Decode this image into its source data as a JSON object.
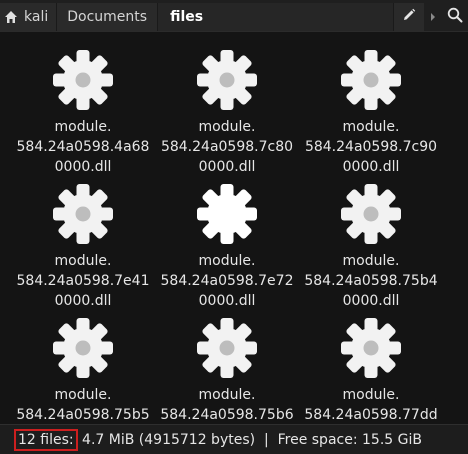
{
  "pathbar": {
    "crumbs": [
      "kali",
      "Documents",
      "files"
    ],
    "home_icon": "home-icon",
    "edit_icon": "pencil-icon",
    "next_icon": "chevron-right-icon",
    "search_icon": "search-icon"
  },
  "files": [
    {
      "line1": "module.",
      "line2": "584.24a0598.4a68",
      "line3": "0000.dll"
    },
    {
      "line1": "module.",
      "line2": "584.24a0598.7c80",
      "line3": "0000.dll"
    },
    {
      "line1": "module.",
      "line2": "584.24a0598.7c90",
      "line3": "0000.dll"
    },
    {
      "line1": "module.",
      "line2": "584.24a0598.7e41",
      "line3": "0000.dll"
    },
    {
      "line1": "module.",
      "line2": "584.24a0598.7e72",
      "line3": "0000.dll"
    },
    {
      "line1": "module.",
      "line2": "584.24a0598.75b4",
      "line3": "0000.dll"
    },
    {
      "line1": "module.",
      "line2": "584.24a0598.75b5",
      "line3": ""
    },
    {
      "line1": "module.",
      "line2": "584.24a0598.75b6",
      "line3": ""
    },
    {
      "line1": "module.",
      "line2": "584.24a0598.77dd",
      "line3": ""
    }
  ],
  "file_icon": "gear-icon",
  "status": {
    "count": "12 files:",
    "details": " 4.7 MiB (4915712 bytes)  |  Free space: 15.5 GiB"
  }
}
